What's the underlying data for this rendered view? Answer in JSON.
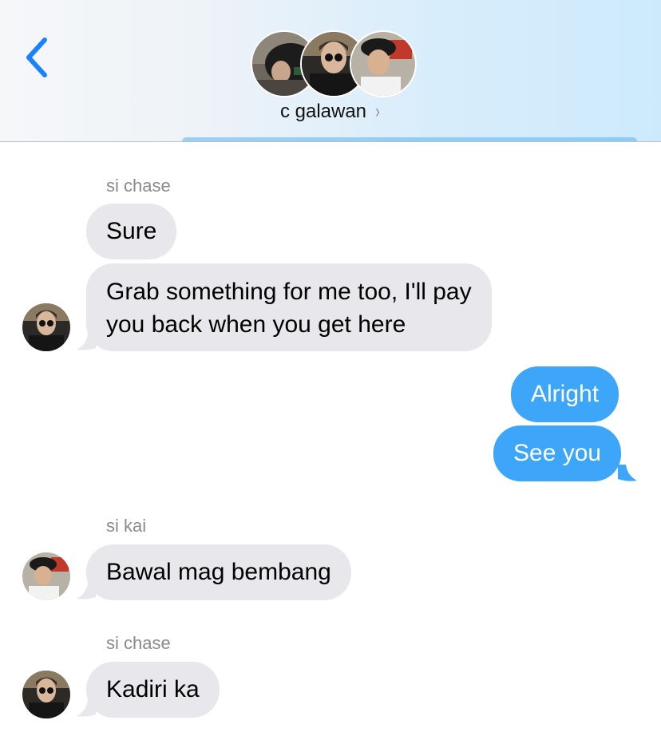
{
  "header": {
    "title": "c galawan",
    "title_chevron": "›",
    "back_icon": "chevron-left-icon",
    "accent_color": "#1a82fb"
  },
  "messages": {
    "sender_1": "si chase",
    "msg_1": "Sure",
    "msg_2_line1": "Grab something for me too, I'll pay",
    "msg_2_line2": "you back when you get here",
    "msg_3": "Alright",
    "msg_4": "See you",
    "sender_2": "si kai",
    "msg_5": "Bawal mag bembang",
    "sender_3": "si chase",
    "msg_6": "Kadiri ka"
  },
  "colors": {
    "incoming_bubble": "#e8e8ec",
    "outgoing_bubble": "#3ea6f8",
    "sender_label": "#8a8a8e"
  }
}
